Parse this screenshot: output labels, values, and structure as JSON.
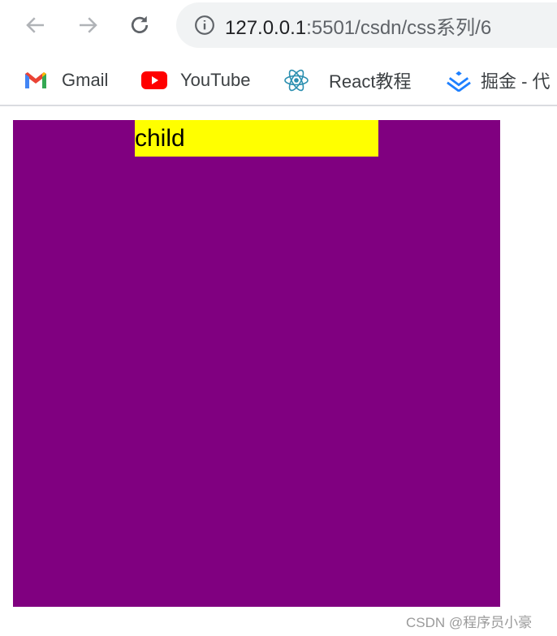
{
  "browser": {
    "back_icon": "arrow-left-icon",
    "forward_icon": "arrow-right-icon",
    "reload_icon": "reload-icon",
    "url_host": "127.0.0.1",
    "url_rest": ":5501/csdn/css系列/6",
    "bookmarks": [
      {
        "label": "Gmail",
        "icon": "gmail-icon"
      },
      {
        "label": "YouTube",
        "icon": "youtube-icon"
      },
      {
        "label": "React教程",
        "icon": "react-icon"
      },
      {
        "label": "掘金 - 代",
        "icon": "juejin-icon"
      }
    ]
  },
  "page": {
    "child_text": "child",
    "parent_color": "#800080",
    "child_color": "#ffff00"
  },
  "watermark": "CSDN @程序员小豪"
}
